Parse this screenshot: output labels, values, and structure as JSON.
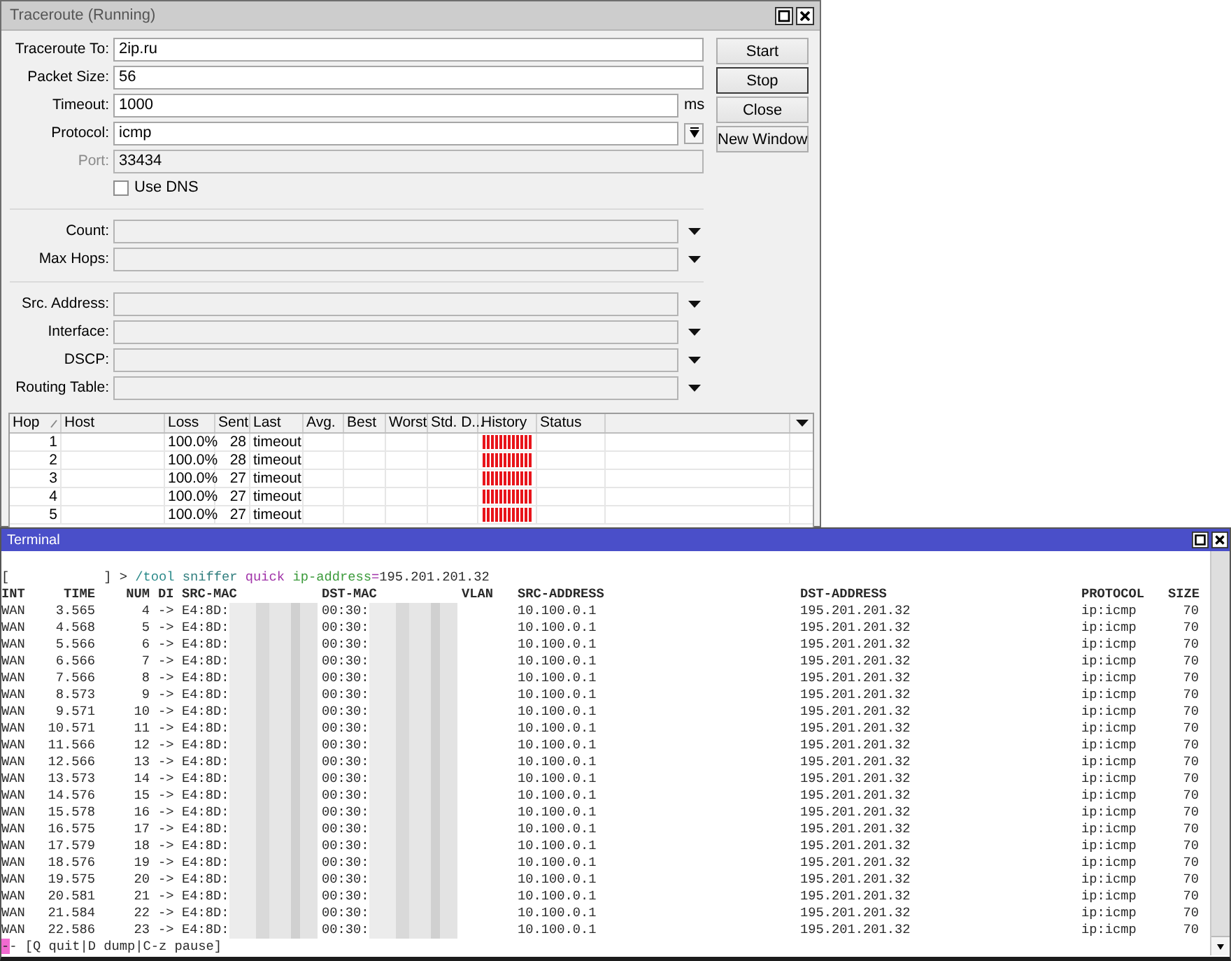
{
  "traceroute_window": {
    "title": "Traceroute (Running)",
    "active": false,
    "sections": [
      [
        {
          "label": "Traceroute To:",
          "value": "2ip.ru",
          "kind": "text",
          "disabled": false
        },
        {
          "label": "Packet Size:",
          "value": "56",
          "kind": "text",
          "disabled": false
        },
        {
          "label": "Timeout:",
          "value": "1000",
          "kind": "unit",
          "unit": "ms",
          "disabled": false
        },
        {
          "label": "Protocol:",
          "value": "icmp",
          "kind": "select",
          "disabled": false
        },
        {
          "label": "Port:",
          "value": "33434",
          "kind": "text",
          "disabled": true
        },
        {
          "label": "Use DNS",
          "kind": "checkbox",
          "checked": false
        }
      ],
      [
        {
          "label": "Count:",
          "kind": "combo"
        },
        {
          "label": "Max Hops:",
          "kind": "combo"
        }
      ],
      [
        {
          "label": "Src. Address:",
          "kind": "combo"
        },
        {
          "label": "Interface:",
          "kind": "combo"
        },
        {
          "label": "DSCP:",
          "kind": "combo"
        },
        {
          "label": "Routing Table:",
          "kind": "combo"
        }
      ]
    ],
    "buttons": [
      {
        "label": "Start",
        "focused": false
      },
      {
        "label": "Stop",
        "focused": true
      },
      {
        "label": "Close",
        "focused": false
      },
      {
        "label": "New Window",
        "focused": false
      }
    ],
    "table": {
      "columns": [
        "Hop",
        "Host",
        "Loss",
        "Sent",
        "Last",
        "Avg.",
        "Best",
        "Worst",
        "Std. D...",
        "History",
        "Status"
      ],
      "rows": [
        {
          "hop": "1",
          "loss": "100.0%",
          "sent": "28",
          "last": "timeout"
        },
        {
          "hop": "2",
          "loss": "100.0%",
          "sent": "28",
          "last": "timeout"
        },
        {
          "hop": "3",
          "loss": "100.0%",
          "sent": "27",
          "last": "timeout"
        },
        {
          "hop": "4",
          "loss": "100.0%",
          "sent": "27",
          "last": "timeout"
        },
        {
          "hop": "5",
          "loss": "100.0%",
          "sent": "27",
          "last": "timeout"
        }
      ]
    }
  },
  "terminal_window": {
    "title": "Terminal",
    "active": true,
    "command_line": [
      {
        "kind": "prompt",
        "text": "[            ] > "
      },
      {
        "kind": "path",
        "text": "/tool "
      },
      {
        "kind": "command",
        "text": "sniffer "
      },
      {
        "kind": "subcommand",
        "text": "quick "
      },
      {
        "kind": "param",
        "text": "ip-address"
      },
      {
        "kind": "operator",
        "text": "="
      },
      {
        "kind": "value",
        "text": "195.201.201.32"
      }
    ],
    "columns": [
      "INT",
      "TIME",
      "NUM",
      "DI",
      "SRC-MAC",
      "DST-MAC",
      "VLAN",
      "SRC-ADDRESS",
      "DST-ADDRESS",
      "PROTOCOL",
      "SIZE"
    ],
    "rows": [
      {
        "int": "WAN",
        "time": "3.565",
        "num": "4",
        "dir": "->",
        "src_mac": "E4:8D:",
        "dst_mac": "00:30:",
        "src_address": "10.100.0.1",
        "dst_address": "195.201.201.32",
        "protocol": "ip:icmp",
        "size": "70"
      },
      {
        "int": "WAN",
        "time": "4.568",
        "num": "5",
        "dir": "->",
        "src_mac": "E4:8D:",
        "dst_mac": "00:30:",
        "src_address": "10.100.0.1",
        "dst_address": "195.201.201.32",
        "protocol": "ip:icmp",
        "size": "70"
      },
      {
        "int": "WAN",
        "time": "5.566",
        "num": "6",
        "dir": "->",
        "src_mac": "E4:8D:",
        "dst_mac": "00:30:",
        "src_address": "10.100.0.1",
        "dst_address": "195.201.201.32",
        "protocol": "ip:icmp",
        "size": "70"
      },
      {
        "int": "WAN",
        "time": "6.566",
        "num": "7",
        "dir": "->",
        "src_mac": "E4:8D:",
        "dst_mac": "00:30:",
        "src_address": "10.100.0.1",
        "dst_address": "195.201.201.32",
        "protocol": "ip:icmp",
        "size": "70"
      },
      {
        "int": "WAN",
        "time": "7.566",
        "num": "8",
        "dir": "->",
        "src_mac": "E4:8D:",
        "dst_mac": "00:30:",
        "src_address": "10.100.0.1",
        "dst_address": "195.201.201.32",
        "protocol": "ip:icmp",
        "size": "70"
      },
      {
        "int": "WAN",
        "time": "8.573",
        "num": "9",
        "dir": "->",
        "src_mac": "E4:8D:",
        "dst_mac": "00:30:",
        "src_address": "10.100.0.1",
        "dst_address": "195.201.201.32",
        "protocol": "ip:icmp",
        "size": "70"
      },
      {
        "int": "WAN",
        "time": "9.571",
        "num": "10",
        "dir": "->",
        "src_mac": "E4:8D:",
        "dst_mac": "00:30:",
        "src_address": "10.100.0.1",
        "dst_address": "195.201.201.32",
        "protocol": "ip:icmp",
        "size": "70"
      },
      {
        "int": "WAN",
        "time": "10.571",
        "num": "11",
        "dir": "->",
        "src_mac": "E4:8D:",
        "dst_mac": "00:30:",
        "src_address": "10.100.0.1",
        "dst_address": "195.201.201.32",
        "protocol": "ip:icmp",
        "size": "70"
      },
      {
        "int": "WAN",
        "time": "11.566",
        "num": "12",
        "dir": "->",
        "src_mac": "E4:8D:",
        "dst_mac": "00:30:",
        "src_address": "10.100.0.1",
        "dst_address": "195.201.201.32",
        "protocol": "ip:icmp",
        "size": "70"
      },
      {
        "int": "WAN",
        "time": "12.566",
        "num": "13",
        "dir": "->",
        "src_mac": "E4:8D:",
        "dst_mac": "00:30:",
        "src_address": "10.100.0.1",
        "dst_address": "195.201.201.32",
        "protocol": "ip:icmp",
        "size": "70"
      },
      {
        "int": "WAN",
        "time": "13.573",
        "num": "14",
        "dir": "->",
        "src_mac": "E4:8D:",
        "dst_mac": "00:30:",
        "src_address": "10.100.0.1",
        "dst_address": "195.201.201.32",
        "protocol": "ip:icmp",
        "size": "70"
      },
      {
        "int": "WAN",
        "time": "14.576",
        "num": "15",
        "dir": "->",
        "src_mac": "E4:8D:",
        "dst_mac": "00:30:",
        "src_address": "10.100.0.1",
        "dst_address": "195.201.201.32",
        "protocol": "ip:icmp",
        "size": "70"
      },
      {
        "int": "WAN",
        "time": "15.578",
        "num": "16",
        "dir": "->",
        "src_mac": "E4:8D:",
        "dst_mac": "00:30:",
        "src_address": "10.100.0.1",
        "dst_address": "195.201.201.32",
        "protocol": "ip:icmp",
        "size": "70"
      },
      {
        "int": "WAN",
        "time": "16.575",
        "num": "17",
        "dir": "->",
        "src_mac": "E4:8D:",
        "dst_mac": "00:30:",
        "src_address": "10.100.0.1",
        "dst_address": "195.201.201.32",
        "protocol": "ip:icmp",
        "size": "70"
      },
      {
        "int": "WAN",
        "time": "17.579",
        "num": "18",
        "dir": "->",
        "src_mac": "E4:8D:",
        "dst_mac": "00:30:",
        "src_address": "10.100.0.1",
        "dst_address": "195.201.201.32",
        "protocol": "ip:icmp",
        "size": "70"
      },
      {
        "int": "WAN",
        "time": "18.576",
        "num": "19",
        "dir": "->",
        "src_mac": "E4:8D:",
        "dst_mac": "00:30:",
        "src_address": "10.100.0.1",
        "dst_address": "195.201.201.32",
        "protocol": "ip:icmp",
        "size": "70"
      },
      {
        "int": "WAN",
        "time": "19.575",
        "num": "20",
        "dir": "->",
        "src_mac": "E4:8D:",
        "dst_mac": "00:30:",
        "src_address": "10.100.0.1",
        "dst_address": "195.201.201.32",
        "protocol": "ip:icmp",
        "size": "70"
      },
      {
        "int": "WAN",
        "time": "20.581",
        "num": "21",
        "dir": "->",
        "src_mac": "E4:8D:",
        "dst_mac": "00:30:",
        "src_address": "10.100.0.1",
        "dst_address": "195.201.201.32",
        "protocol": "ip:icmp",
        "size": "70"
      },
      {
        "int": "WAN",
        "time": "21.584",
        "num": "22",
        "dir": "->",
        "src_mac": "E4:8D:",
        "dst_mac": "00:30:",
        "src_address": "10.100.0.1",
        "dst_address": "195.201.201.32",
        "protocol": "ip:icmp",
        "size": "70"
      },
      {
        "int": "WAN",
        "time": "22.586",
        "num": "23",
        "dir": "->",
        "src_mac": "E4:8D:",
        "dst_mac": "00:30:",
        "src_address": "10.100.0.1",
        "dst_address": "195.201.201.32",
        "protocol": "ip:icmp",
        "size": "70"
      }
    ],
    "status_line": "-- [Q quit|D dump|C-z pause]",
    "cursor_visible": true
  }
}
